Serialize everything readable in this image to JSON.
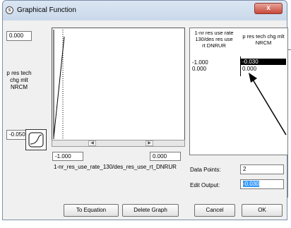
{
  "window": {
    "title": "Graphical Function",
    "close_label": "x"
  },
  "graph": {
    "y_max": "0.000",
    "y_min": "-0.050",
    "y_label": "p res tech\nchg mlt\nNRCM",
    "x_min": "-1.000",
    "x_max": "0.000",
    "x_label": "1-nr_res_use_rate_130/des_res_use_rt_DNRUR"
  },
  "table": {
    "col1_header": "1-nr res use rate\n130/des res use\nrt DNRUR",
    "col2_header": "p res tech chg mlt\nNRCM",
    "rows": [
      {
        "x": "-1.000",
        "y": "-0.030"
      },
      {
        "x": "0.000",
        "y": "0.000"
      }
    ]
  },
  "fields": {
    "data_points_label": "Data Points:",
    "data_points_value": "2",
    "edit_output_label": "Edit Output:",
    "edit_output_value": "-0.030"
  },
  "buttons": {
    "to_equation": "To Equation",
    "delete_graph": "Delete Graph",
    "cancel": "Cancel",
    "ok": "OK"
  },
  "colors": {
    "selection": "#000000",
    "edit_highlight": "#3399ff"
  }
}
